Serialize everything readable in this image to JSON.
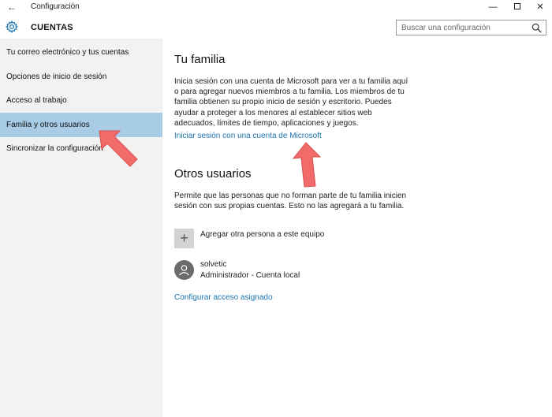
{
  "window": {
    "title": "Configuración",
    "back_glyph": "←",
    "minimize_glyph": "—",
    "close_glyph": "✕"
  },
  "header": {
    "section_title": "CUENTAS",
    "search_placeholder": "Buscar una configuración",
    "icon": "gear-icon",
    "search_icon": "search-icon"
  },
  "sidebar": {
    "items": [
      {
        "label": "Tu correo electrónico y tus cuentas",
        "active": false
      },
      {
        "label": "Opciones de inicio de sesión",
        "active": false
      },
      {
        "label": "Acceso al trabajo",
        "active": false
      },
      {
        "label": "Familia y otros usuarios",
        "active": true
      },
      {
        "label": "Sincronizar la configuración",
        "active": false
      }
    ]
  },
  "family": {
    "heading": "Tu familia",
    "description": "Inicia sesión con una cuenta de Microsoft para ver a tu familia aquí o para agregar nuevos miembros a tu familia. Los miembros de tu familia obtienen su propio inicio de sesión y escritorio. Puedes ayudar a proteger a los menores al establecer sitios web adecuados, límites de tiempo, aplicaciones y juegos.",
    "signin_link": "Iniciar sesión con una cuenta de Microsoft"
  },
  "others": {
    "heading": "Otros usuarios",
    "description": "Permite que las personas que no forman parte de tu familia inicien sesión con sus propias cuentas. Esto no las agregará a tu familia.",
    "add_label": "Agregar otra persona a este equipo",
    "add_glyph": "+",
    "user": {
      "name": "solvetic",
      "role": "Administrador - Cuenta local"
    },
    "assigned_access_link": "Configurar acceso asignado"
  },
  "colors": {
    "accent_link": "#1a73b0",
    "sidebar_bg": "#f2f2f2",
    "sidebar_active": "#a9cce6",
    "annotation_arrow": "#f26b6b"
  }
}
